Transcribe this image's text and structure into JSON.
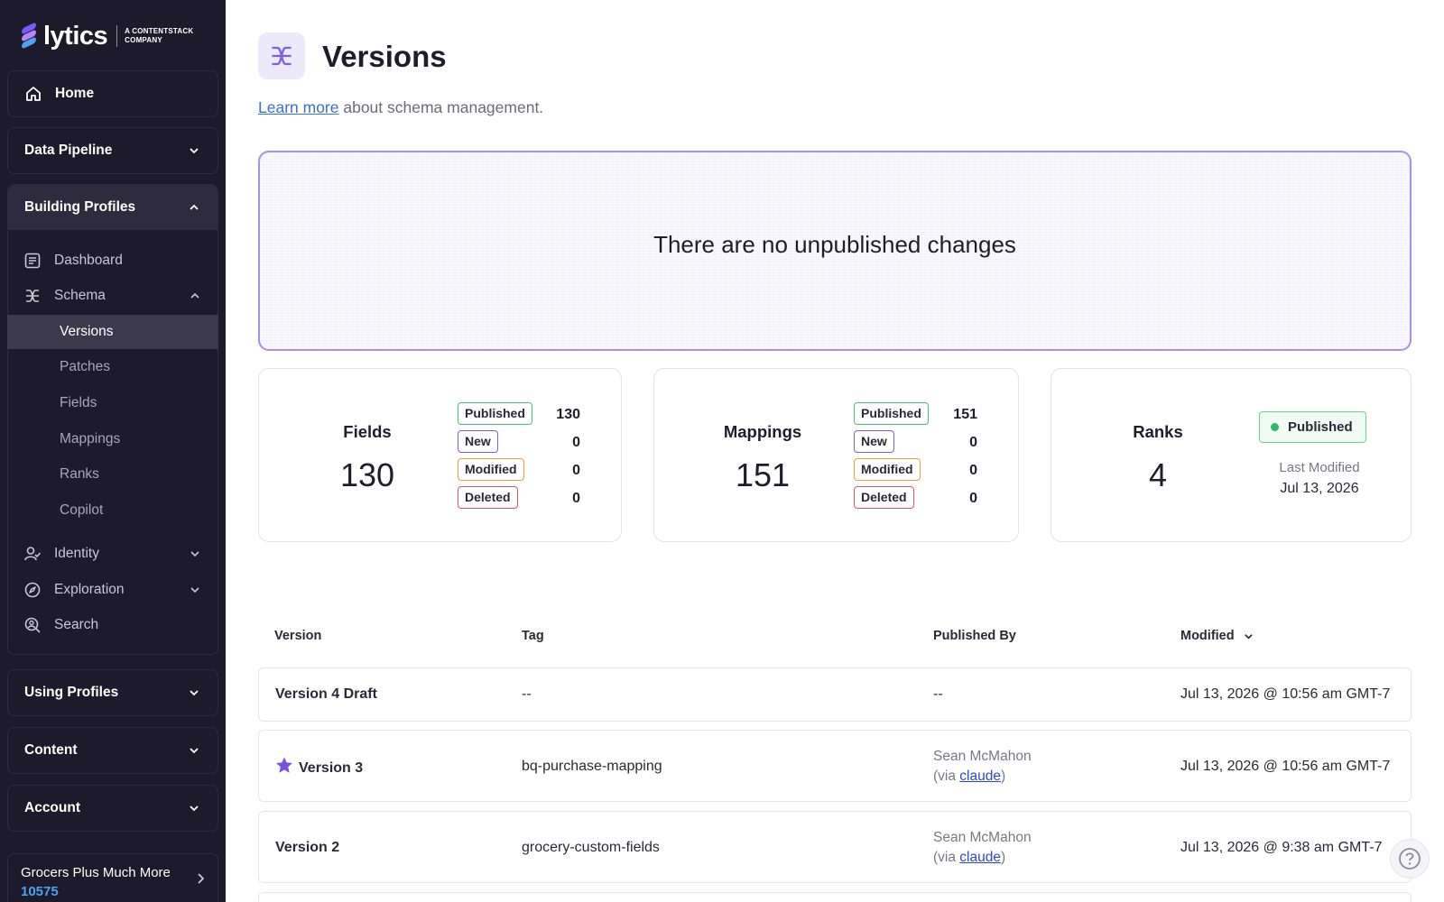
{
  "brand": {
    "wordmark": "lytics",
    "tagline_line1": "A CONTENTSTACK",
    "tagline_line2": "COMPANY"
  },
  "sidebar": {
    "home": "Home",
    "data_pipeline": "Data Pipeline",
    "building_profiles": "Building Profiles",
    "items": {
      "dashboard": "Dashboard",
      "schema": "Schema",
      "versions": "Versions",
      "patches": "Patches",
      "fields": "Fields",
      "mappings": "Mappings",
      "ranks": "Ranks",
      "copilot": "Copilot",
      "identity": "Identity",
      "exploration": "Exploration",
      "search": "Search"
    },
    "using_profiles": "Using Profiles",
    "content": "Content",
    "account": "Account",
    "account_name": "Grocers Plus Much More",
    "account_id": "10575"
  },
  "page": {
    "title": "Versions",
    "learn_more_link": "Learn more",
    "learn_more_rest": " about schema management."
  },
  "banner": {
    "message": "There are no unpublished changes"
  },
  "stats": {
    "fields": {
      "label": "Fields",
      "total": "130",
      "published": "130",
      "new": "0",
      "modified": "0",
      "deleted": "0"
    },
    "mappings": {
      "label": "Mappings",
      "total": "151",
      "published": "151",
      "new": "0",
      "modified": "0",
      "deleted": "0"
    },
    "ranks": {
      "label": "Ranks",
      "total": "4",
      "status": "Published",
      "last_modified_label": "Last Modified",
      "last_modified_date": "Jul 13, 2026"
    },
    "badge_labels": {
      "published": "Published",
      "new": "New",
      "modified": "Modified",
      "deleted": "Deleted"
    }
  },
  "table": {
    "headers": {
      "version": "Version",
      "tag": "Tag",
      "published_by": "Published By",
      "modified": "Modified"
    },
    "rows": [
      {
        "version": "Version 4 Draft",
        "tag": "--",
        "published_by": "--",
        "via_prefix": "",
        "via_link": "",
        "via_suffix": "",
        "modified": "Jul 13, 2026 @ 10:56 am GMT-7"
      },
      {
        "version": "Version 3",
        "tag": "bq-purchase-mapping",
        "published_by": "Sean McMahon",
        "via_prefix": "(via ",
        "via_link": "claude",
        "via_suffix": ")",
        "modified": "Jul 13, 2026 @ 10:56 am GMT-7"
      },
      {
        "version": "Version 2",
        "tag": "grocery-custom-fields",
        "published_by": "Sean McMahon",
        "via_prefix": "(via ",
        "via_link": "claude",
        "via_suffix": ")",
        "modified": "Jul 13, 2026 @ 9:38 am GMT-7"
      }
    ]
  },
  "colors": {
    "sidebar_bg": "#1c1a2b",
    "accent": "#a88ff0",
    "published": "#4dbb77",
    "new": "#7d5ee8",
    "modified": "#eaa13c",
    "deleted": "#e05566",
    "star": "#7a4fe6"
  }
}
